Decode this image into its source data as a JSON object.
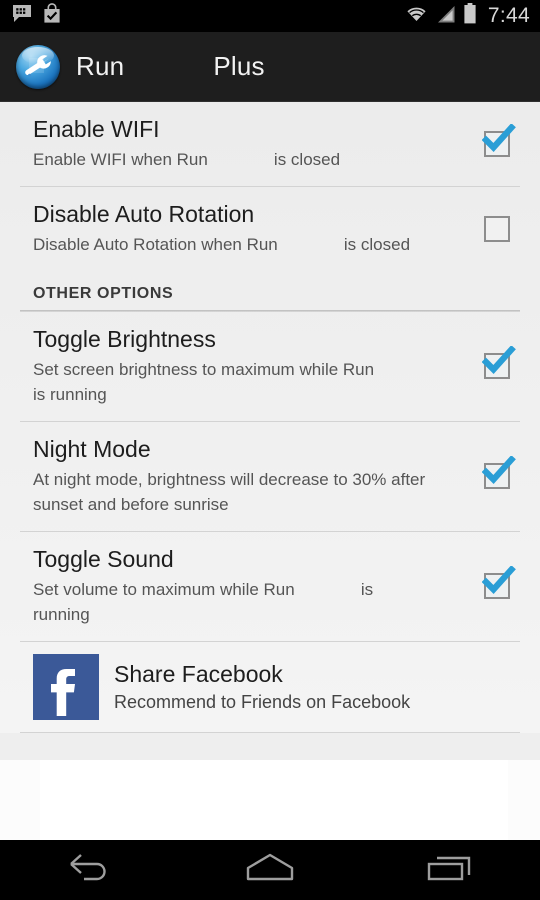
{
  "status_bar": {
    "time": "7:44",
    "left_icons": [
      "bbm-chat-icon",
      "play-store-download-icon"
    ],
    "right_icons": [
      "wifi-icon",
      "cellular-signal-icon",
      "battery-icon"
    ],
    "background": "#000000"
  },
  "action_bar": {
    "app_icon": "wrench-tool-icon",
    "title": "Run            Plus",
    "background": "#1e1e1e",
    "text_color": "#f2f2f2"
  },
  "settings": {
    "top_items": [
      {
        "title": "Enable WIFI",
        "summary": "Enable WIFI when Run              is closed",
        "checked": true,
        "name": "enable-wifi"
      },
      {
        "title": "Disable Auto Rotation",
        "summary": "Disable Auto Rotation when Run              is closed",
        "checked": false,
        "name": "disable-auto-rotation"
      }
    ],
    "section_header": "OTHER OPTIONS",
    "other_items": [
      {
        "title": "Toggle Brightness",
        "summary": "Set screen brightness to maximum while Run              is running",
        "checked": true,
        "name": "toggle-brightness"
      },
      {
        "title": "Night Mode",
        "summary": "At night mode, brightness will decrease to 30% after sunset and before sunrise",
        "checked": true,
        "name": "night-mode"
      },
      {
        "title": "Toggle Sound",
        "summary": "Set volume to maximum while Run              is running",
        "checked": true,
        "name": "toggle-sound"
      }
    ],
    "share": {
      "title": "Share Facebook",
      "summary": "Recommend to Friends on Facebook",
      "icon": "facebook-icon",
      "icon_color": "#3b5998",
      "glyph": "f"
    },
    "checkbox_accent": "#2a9ed6",
    "checkbox_border": "#8d8d8d",
    "list_background": "#efefef"
  },
  "nav_bar": {
    "buttons": [
      {
        "name": "back-button",
        "icon": "back-arrow-icon"
      },
      {
        "name": "home-button",
        "icon": "home-icon"
      },
      {
        "name": "recents-button",
        "icon": "recent-apps-icon"
      }
    ],
    "background": "#000000",
    "icon_color": "#9e9e9e"
  }
}
